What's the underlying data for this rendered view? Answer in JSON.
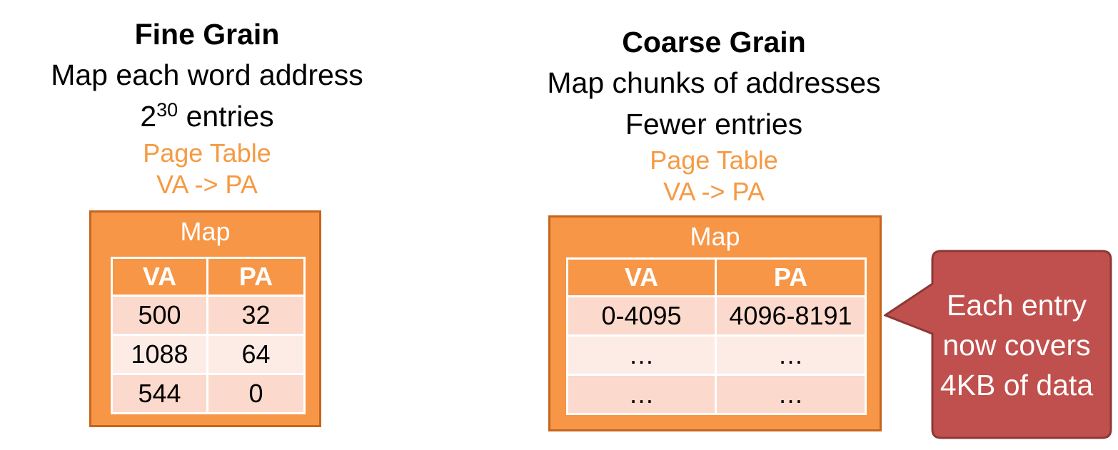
{
  "fine": {
    "title": "Fine Grain",
    "line1": "Map each word address",
    "entries_base": "2",
    "entries_exp": "30",
    "entries_suffix": " entries",
    "pt_label": "Page Table",
    "pt_mapping": "VA -> PA",
    "map_title": "Map",
    "headers": [
      "VA",
      "PA"
    ],
    "rows": [
      [
        "500",
        "32"
      ],
      [
        "1088",
        "64"
      ],
      [
        "544",
        "0"
      ]
    ]
  },
  "coarse": {
    "title": "Coarse Grain",
    "line1": "Map chunks of addresses",
    "line2": "Fewer entries",
    "pt_label": "Page Table",
    "pt_mapping": "VA -> PA",
    "map_title": "Map",
    "headers": [
      "VA",
      "PA"
    ],
    "rows": [
      [
        "0-4095",
        "4096-8191"
      ],
      [
        "…",
        "…"
      ],
      [
        "…",
        "…"
      ]
    ]
  },
  "callout": {
    "lines": [
      "Each entry",
      "now covers",
      "4KB of data"
    ]
  },
  "colors": {
    "orange": "#f79646",
    "orange_text": "#f59a43",
    "callout_fill": "#c0504d",
    "row_dark": "#fbd9cc",
    "row_light": "#fdece6"
  }
}
